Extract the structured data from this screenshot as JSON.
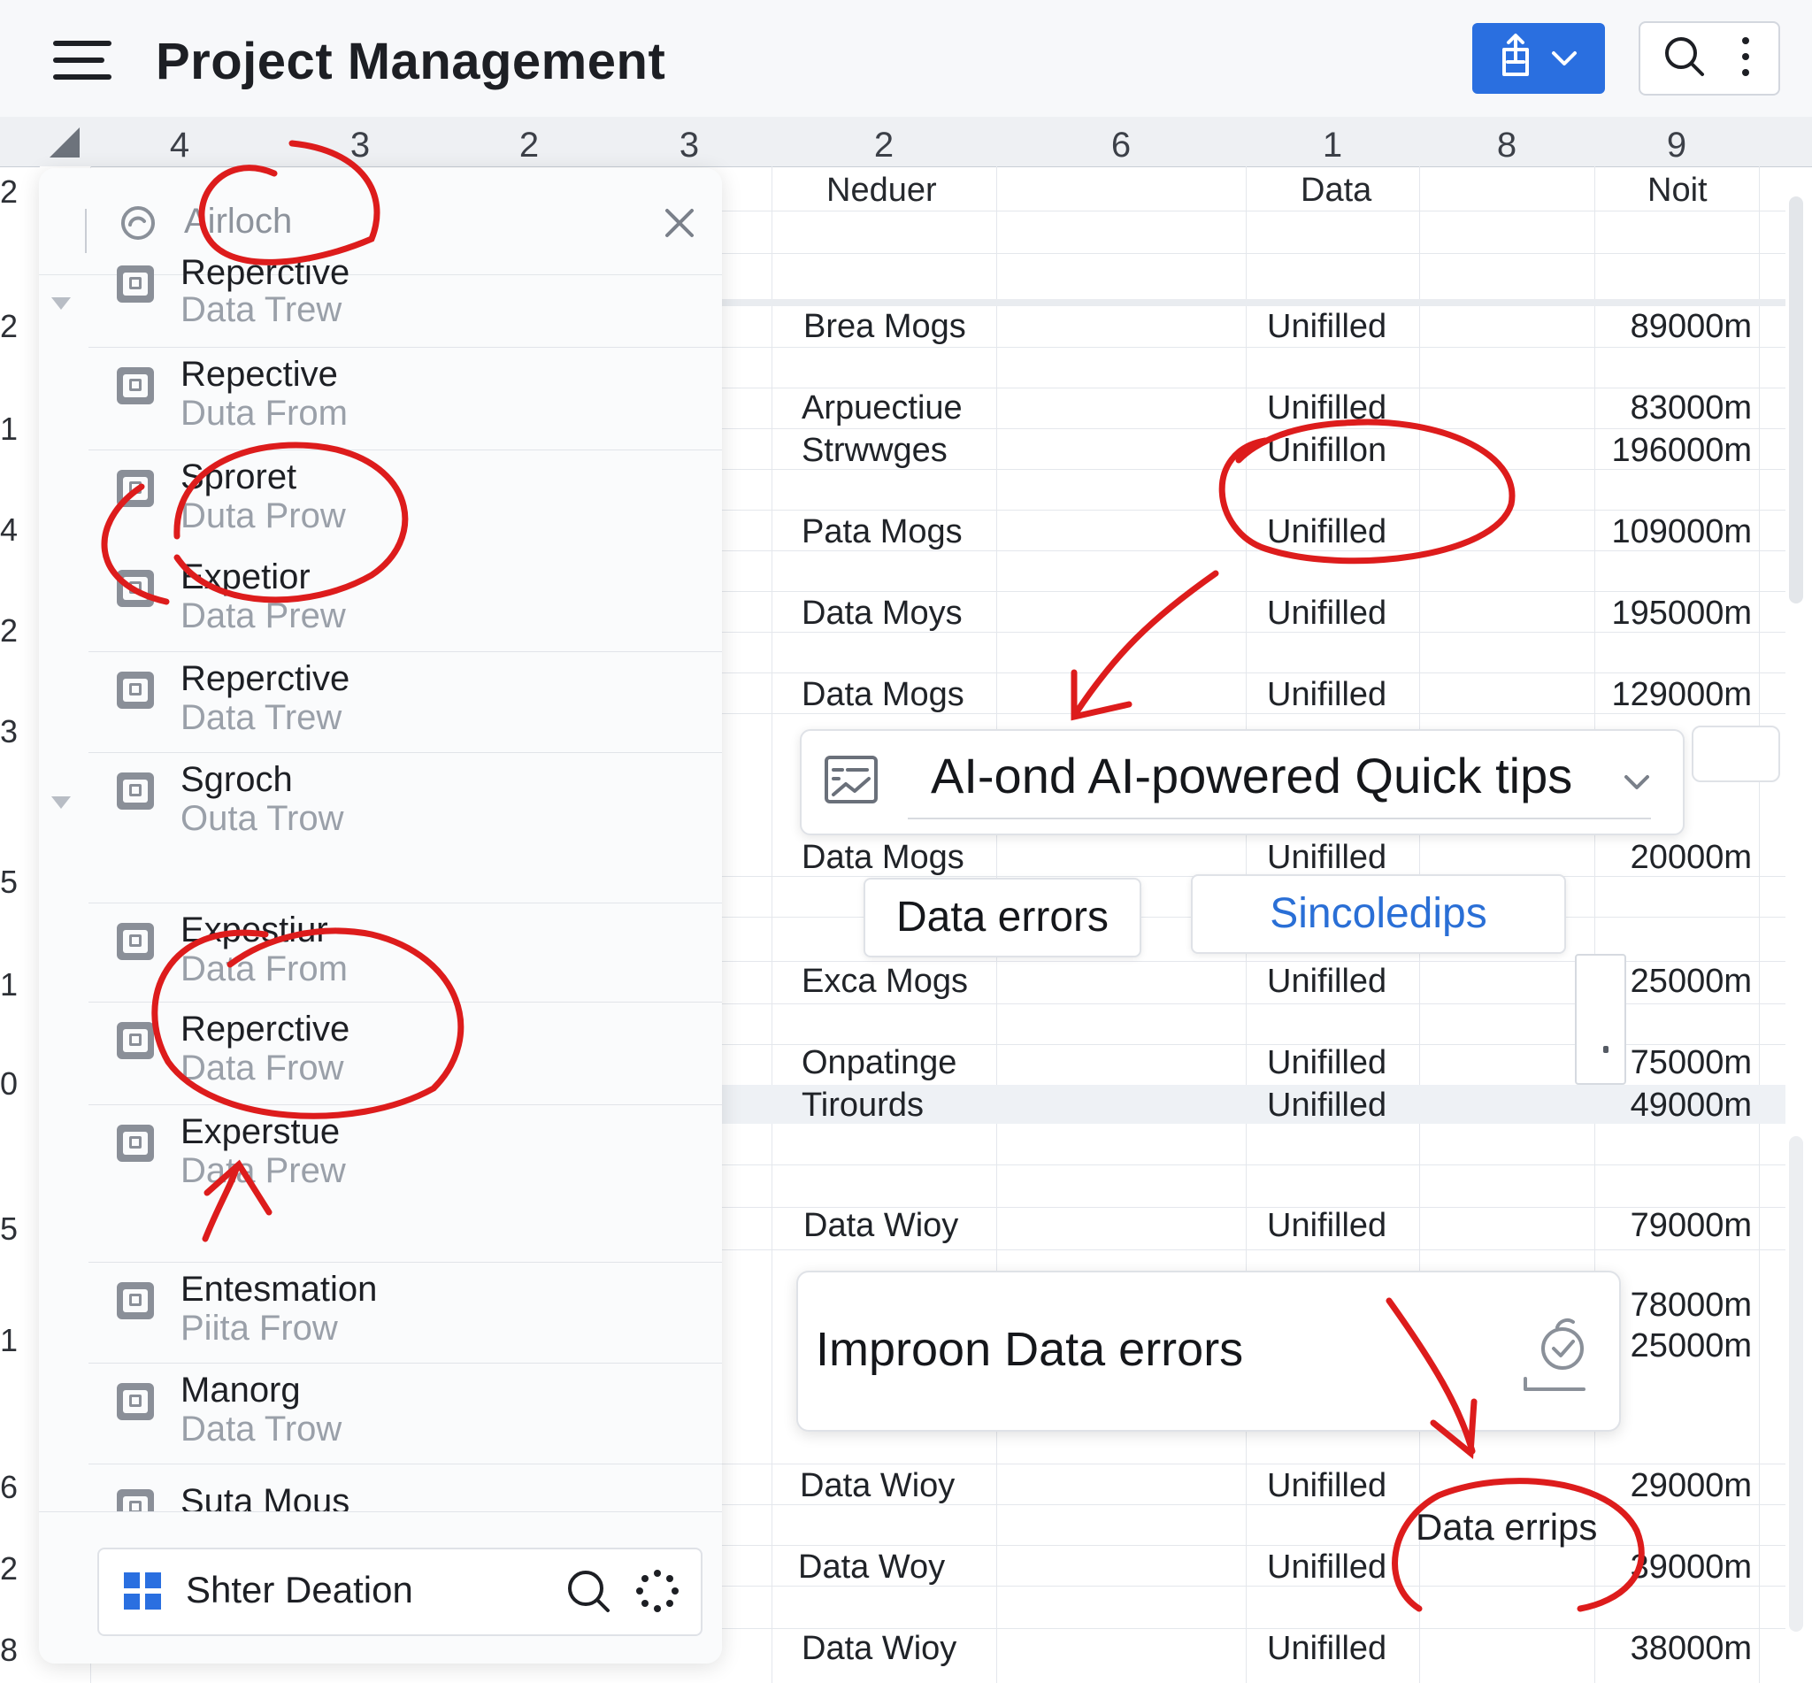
{
  "header": {
    "title": "Project Management"
  },
  "columns": [
    "4",
    "3",
    "2",
    "3",
    "2",
    "6",
    "1",
    "8",
    "9"
  ],
  "row_numbers": [
    "2",
    "2",
    "1",
    "4",
    "2",
    "3",
    "5",
    "1",
    "0",
    "5",
    "1",
    "6",
    "2",
    "8"
  ],
  "field_headers": {
    "name": "Neduer",
    "status": "Data",
    "value": "Noit"
  },
  "rows": [
    {
      "name": "Brea Mogs",
      "status": "Unifilled",
      "value": "89000m"
    },
    {
      "name": "Arpuectiue",
      "status": "Unifilled",
      "value": "83000m"
    },
    {
      "name": "Strwwges",
      "status": "Unifillon",
      "value": "196000m"
    },
    {
      "name": "Pata Mogs",
      "status": "Unifilled",
      "value": "109000m"
    },
    {
      "name": "Data Moys",
      "status": "Unifilled",
      "value": "195000m"
    },
    {
      "name": "Data Mogs",
      "status": "Unifilled",
      "value": "129000m"
    },
    {
      "name": "Data Mogs",
      "status": "Unifilled",
      "value": "20000m"
    },
    {
      "name": "Exca Mogs",
      "status": "Unifilled",
      "value": "25000m"
    },
    {
      "name": "Onpatinge",
      "status": "Unifilled",
      "value": "75000m"
    },
    {
      "name": "Tirourds",
      "status": "Unifilled",
      "value": "49000m"
    },
    {
      "name": "Data Wioy",
      "status": "Unifilled",
      "value": "79000m"
    },
    {
      "name": "",
      "status": "",
      "value": "78000m"
    },
    {
      "name": "",
      "status": "",
      "value": "25000m"
    },
    {
      "name": "Data Wioy",
      "status": "Unifilled",
      "value": "29000m"
    },
    {
      "name": "Data Woy",
      "status": "Unifilled",
      "value": "39000m"
    },
    {
      "name": "Data Wioy",
      "status": "Unifilled",
      "value": "38000m"
    }
  ],
  "panel": {
    "search_value": "Airloch",
    "items": [
      {
        "title": "Reperctive",
        "subtitle": "Data Trew"
      },
      {
        "title": "Repective",
        "subtitle": "Duta From"
      },
      {
        "title": "Sproret",
        "subtitle": "Duta Prow"
      },
      {
        "title": "Expetior",
        "subtitle": "Data Prew"
      },
      {
        "title": "Reperctive",
        "subtitle": "Data Trew"
      },
      {
        "title": "Sgroch",
        "subtitle": "Outa Trow"
      },
      {
        "title": "Expestiur",
        "subtitle": "Data From"
      },
      {
        "title": "Reperctive",
        "subtitle": "Data Frow"
      },
      {
        "title": "Experstue",
        "subtitle": "Data Prew"
      },
      {
        "title": "Entesmation",
        "subtitle": "Piita Frow"
      },
      {
        "title": "Manorg",
        "subtitle": "Data Trow"
      },
      {
        "title": "Suta Mous",
        "subtitle": ""
      }
    ],
    "footer_label": "Shter Deation"
  },
  "quick_tips": {
    "label": "AI-ond AI-powered Quick tips"
  },
  "chips": {
    "data_errors": "Data errors",
    "suggestions": "Sincoledips"
  },
  "improve_card": {
    "label": "Improon Data errors"
  },
  "annotation": {
    "label": "Data errips"
  },
  "colors": {
    "accent": "#2a6fe0",
    "annotation_red": "#dd1c1c",
    "link_blue": "#2a6fd6"
  }
}
